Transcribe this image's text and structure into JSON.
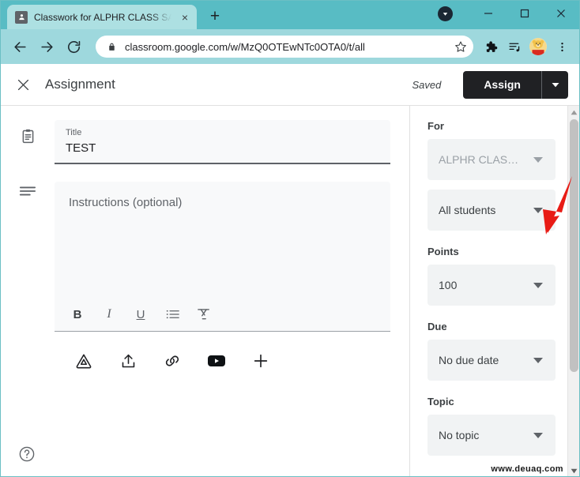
{
  "browser": {
    "tab": {
      "title": "Classwork for ALPHR CLASS SAM",
      "favicon_name": "classroom-favicon",
      "close_label": "×"
    },
    "new_tab_label": "+",
    "window_controls": {
      "download_badge": "download-badge",
      "minimize": "–",
      "maximize": "□",
      "close": "✕"
    },
    "toolbar": {
      "back": "back-arrow",
      "forward": "forward-arrow",
      "reload": "reload-arrow",
      "url": "classroom.google.com/w/MzQ0OTEwNTc0OTA0/t/all",
      "lock_icon": "lock-icon",
      "bookmark_icon": "star-icon",
      "extensions_icon": "puzzle-icon",
      "readinglist_icon": "reading-list-icon",
      "avatar_icon": "profile-avatar",
      "menu_icon": "three-dot-menu"
    }
  },
  "header": {
    "close_label": "✕",
    "title": "Assignment",
    "saved_label": "Saved",
    "assign_label": "Assign",
    "assign_caret": "assign-dropdown-caret"
  },
  "main": {
    "title_field": {
      "label": "Title",
      "value": "TEST",
      "lead_icon": "assignment-clipboard-icon"
    },
    "instructions_field": {
      "placeholder": "Instructions (optional)",
      "lead_icon": "description-lines-icon"
    },
    "rich_toolbar": [
      {
        "name": "bold-button",
        "glyph": "B"
      },
      {
        "name": "italic-button",
        "glyph": "I"
      },
      {
        "name": "underline-button",
        "glyph": "U"
      },
      {
        "name": "bulleted-list-button",
        "glyph": "list"
      },
      {
        "name": "clear-formatting-button",
        "glyph": "clear"
      }
    ],
    "attachments": [
      {
        "name": "google-drive-button",
        "label": "Drive"
      },
      {
        "name": "upload-button",
        "label": "Upload"
      },
      {
        "name": "link-button",
        "label": "Link"
      },
      {
        "name": "youtube-button",
        "label": "YouTube"
      },
      {
        "name": "create-button",
        "label": "Create"
      }
    ],
    "help_label": "?"
  },
  "sidebar": {
    "for": {
      "label": "For",
      "class_value": "ALPHR CLAS…",
      "students_value": "All students"
    },
    "points": {
      "label": "Points",
      "value": "100"
    },
    "due": {
      "label": "Due",
      "value": "No due date"
    },
    "topic": {
      "label": "Topic",
      "value": "No topic"
    }
  },
  "annotation": {
    "arrow_color": "#e81b15",
    "points_to": "all-students-dropdown"
  },
  "watermark": {
    "text": "www.deuaq.com"
  },
  "colors": {
    "tabstrip": "#58bcc4",
    "toolbar": "#9ed8dd",
    "active_tab": "#ade0e2",
    "assign_button": "#202124",
    "field_bg": "#f8f9fa",
    "select_bg": "#f1f3f4"
  }
}
